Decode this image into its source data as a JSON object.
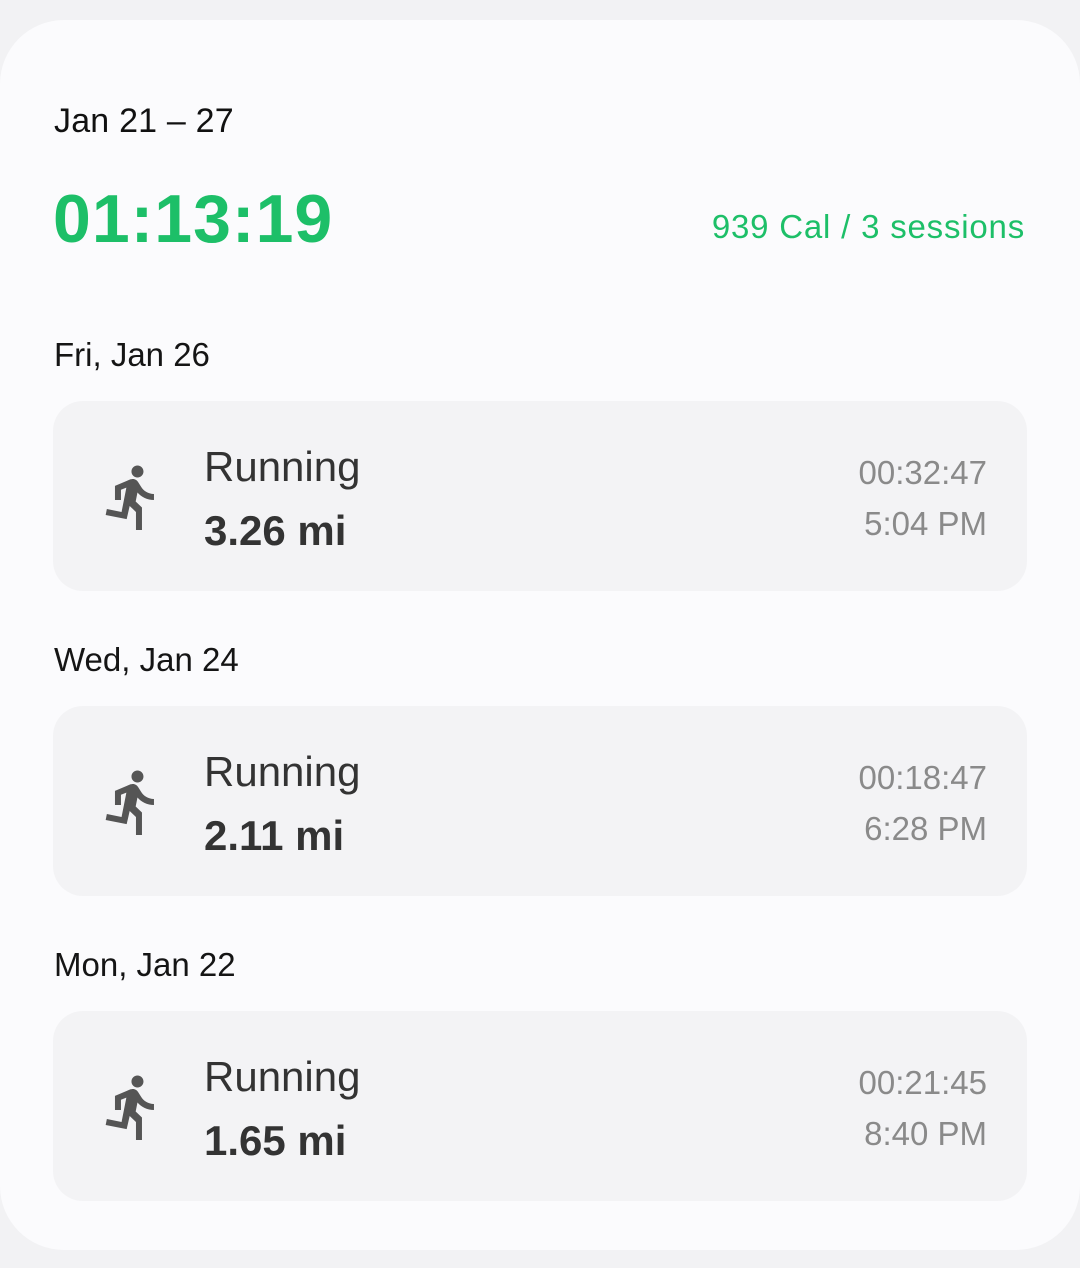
{
  "week": {
    "range": "Jan 21 – 27",
    "total_time": "01:13:19",
    "summary": "939 Cal / 3 sessions"
  },
  "colors": {
    "accent": "#1dbf68",
    "card_bg": "#fbfbfd",
    "session_bg": "#f3f3f5",
    "muted_text": "#8a8a8a"
  },
  "days": [
    {
      "label": "Fri, Jan 26",
      "session": {
        "icon": "running-icon",
        "activity": "Running",
        "distance": "3.26 mi",
        "duration": "00:32:47",
        "start_time": "5:04 PM"
      }
    },
    {
      "label": "Wed, Jan 24",
      "session": {
        "icon": "running-icon",
        "activity": "Running",
        "distance": "2.11 mi",
        "duration": "00:18:47",
        "start_time": "6:28 PM"
      }
    },
    {
      "label": "Mon, Jan 22",
      "session": {
        "icon": "running-icon",
        "activity": "Running",
        "distance": "1.65 mi",
        "duration": "00:21:45",
        "start_time": "8:40 PM"
      }
    }
  ]
}
